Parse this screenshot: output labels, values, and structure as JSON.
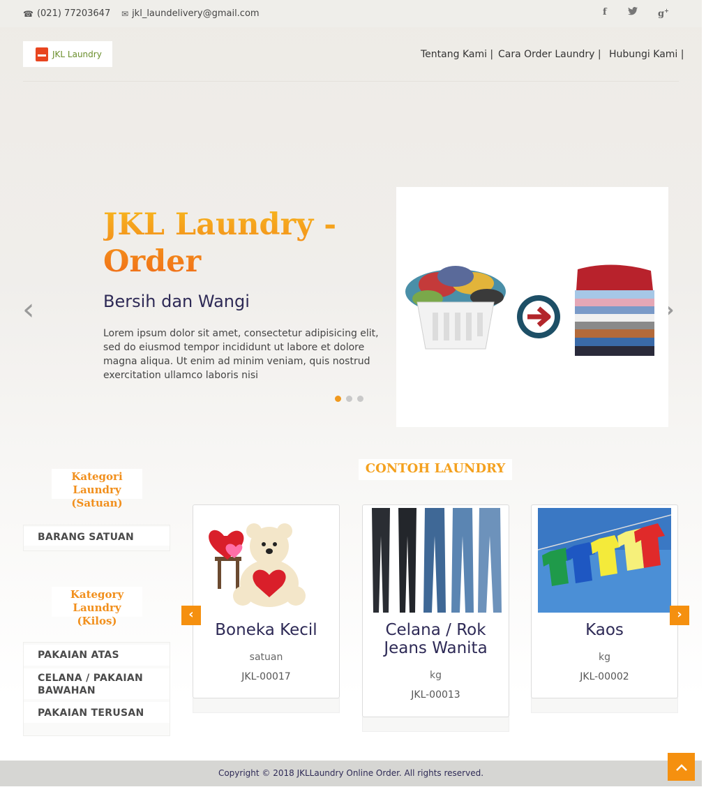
{
  "topbar": {
    "phone": "(021) 77203647",
    "email": "jkl_laundelivery@gmail.com",
    "social": [
      "facebook-icon",
      "twitter-icon",
      "google-plus-icon"
    ]
  },
  "header": {
    "logo_text": "JKL Laundry",
    "nav": [
      "Tentang Kami |",
      "Cara Order Laundry |",
      "Hubungi Kami |"
    ]
  },
  "slider": {
    "title": "JKL Laundry - Order",
    "subtitle": "Bersih dan Wangi",
    "text": "Lorem ipsum dolor sit amet, consectetur adipisicing elit, sed do eiusmod tempor incididunt ut labore et dolore magna aliqua. Ut enim ad minim veniam, quis nostrud exercitation ullamco laboris nisi",
    "prev": "‹",
    "next": "›",
    "active_index": 0,
    "slide_count": 3
  },
  "sidebar": {
    "satuan_heading": "Kategori Laundry (Satuan)",
    "satuan_items": [
      "BARANG SATUAN"
    ],
    "kilos_heading": "Kategory Laundry (Kilos)",
    "kilos_items": [
      "PAKAIAN ATAS",
      "CELANA / PAKAIAN BAWAHAN",
      "PAKAIAN TERUSAN"
    ]
  },
  "products": {
    "heading": "CONTOH LAUNDRY",
    "items": [
      {
        "name": "Boneka Kecil",
        "unit": "satuan",
        "code": "JKL-00017"
      },
      {
        "name": "Celana / Rok Jeans Wanita",
        "unit": "kg",
        "code": "JKL-00013"
      },
      {
        "name": "Kaos",
        "unit": "kg",
        "code": "JKL-00002"
      }
    ],
    "prev": "‹",
    "next": "›"
  },
  "footer": {
    "copyright": "Copyright © 2018 JKLLaundry Online Order. All rights reserved.",
    "to_top": "⌃"
  },
  "colors": {
    "accent": "#f5900f",
    "title_orange": "#f18f1c",
    "navy": "#2e2a56"
  }
}
